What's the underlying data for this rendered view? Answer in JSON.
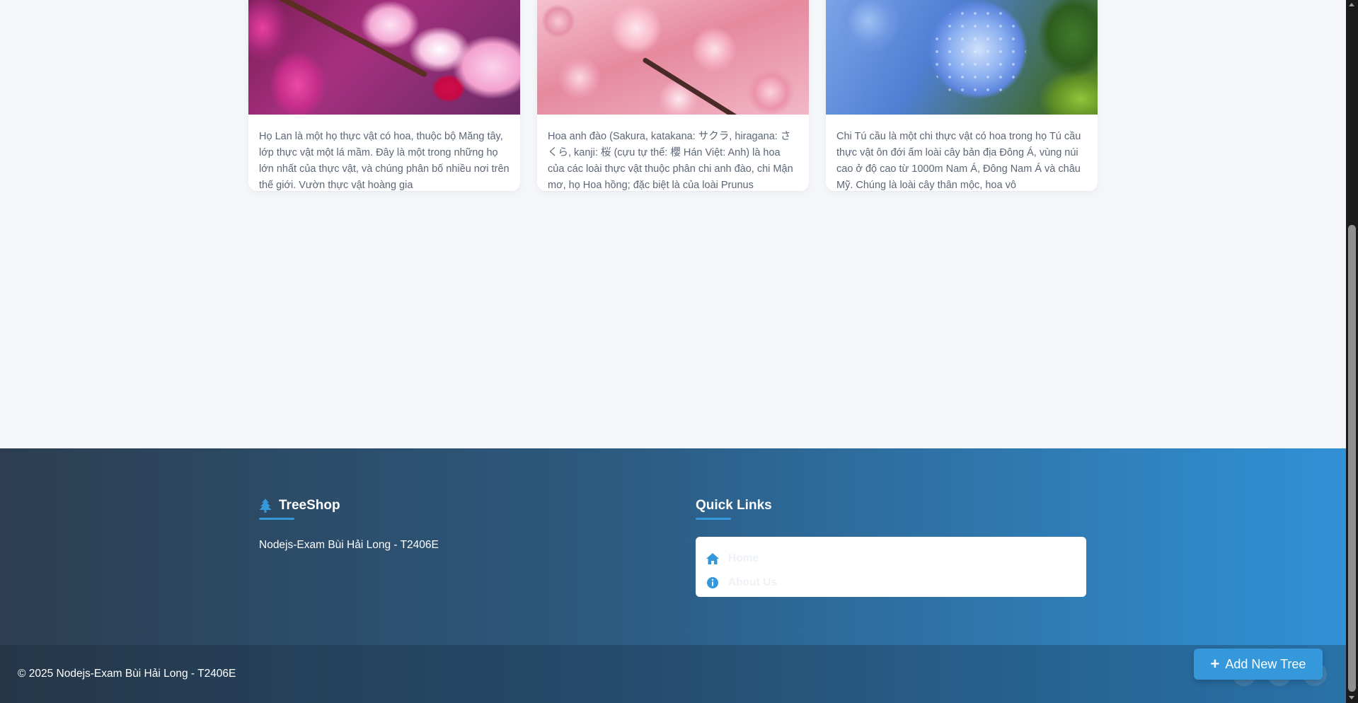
{
  "cards": [
    {
      "image_alt": "Pink orchid",
      "description": "Họ Lan là một họ thực vật có hoa, thuộc bộ Măng tây, lớp thực vật một lá mầm. Đây là một trong những họ lớn nhất của thực vật, và chúng phân bố nhiều nơi trên thế giới. Vườn thực vật hoàng gia"
    },
    {
      "image_alt": "Cherry blossom",
      "description": "Hoa anh đào (Sakura, katakana: サクラ, hiragana: さくら, kanji: 桜 (cựu tự thể: 櫻 Hán Việt: Anh) là hoa của các loài thực vật thuộc phân chi anh đào, chi Mận mơ, họ Hoa hồng; đặc biệt là của loài Prunus"
    },
    {
      "image_alt": "Blue hydrangea",
      "description": "Chi Tú cầu là một chi thực vật có hoa trong họ Tú cầu thực vật ôn đới ấm loài cây bản địa Đông Á, vùng núi cao ở độ cao từ 1000m Nam Á, Đông Nam Á và châu Mỹ. Chúng là loài cây thân mộc, hoa vô"
    }
  ],
  "footer": {
    "brand": "TreeShop",
    "brand_text": "Nodejs-Exam Bùi Hải Long - T2406E",
    "quick_links_title": "Quick Links",
    "links": [
      {
        "label": "Home",
        "icon": "home-icon"
      },
      {
        "label": "About Us",
        "icon": "info-icon"
      }
    ],
    "copyright": "© 2025 Nodejs-Exam Bùi Hải Long - T2406E"
  },
  "add_button": {
    "label": "Add New Tree",
    "icon": "plus-icon"
  },
  "colors": {
    "accent": "#3498db",
    "footer_start": "#2c3e50",
    "footer_end": "#3191d6"
  }
}
